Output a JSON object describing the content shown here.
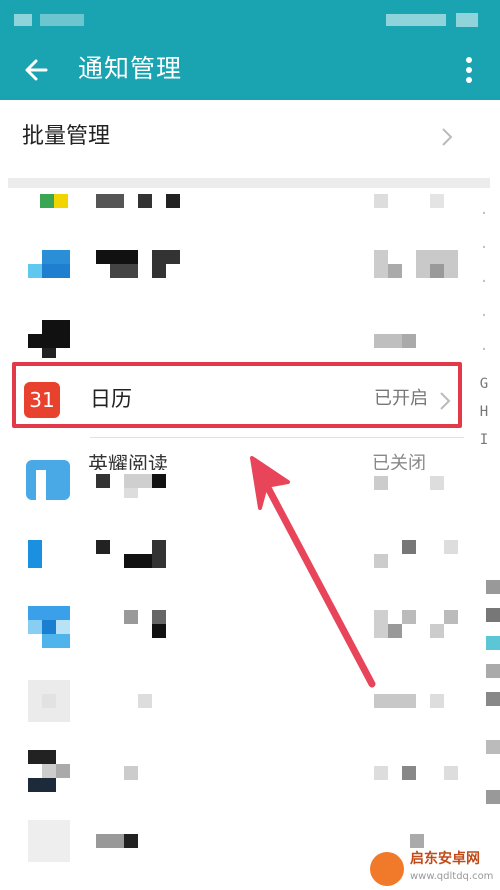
{
  "header": {
    "title": "通知管理"
  },
  "batch": {
    "label": "批量管理"
  },
  "highlighted_app": {
    "icon_text": "31",
    "name": "日历",
    "status": "已开启"
  },
  "cut_app": {
    "name": "英耀阅读",
    "status": "已关闭"
  },
  "alpha_index": {
    "letters": [
      "G",
      "H",
      "I"
    ]
  },
  "icons": {
    "back": "back-arrow-icon",
    "more": "more-vert-icon",
    "chevron": "chevron-right-icon"
  },
  "colors": {
    "app_bar": "#1aa3b1",
    "highlight": "#e33a4a",
    "calendar_icon": "#e8412d"
  },
  "watermark": {
    "name": "启东安卓网",
    "url": "www.qdltdq.com"
  }
}
